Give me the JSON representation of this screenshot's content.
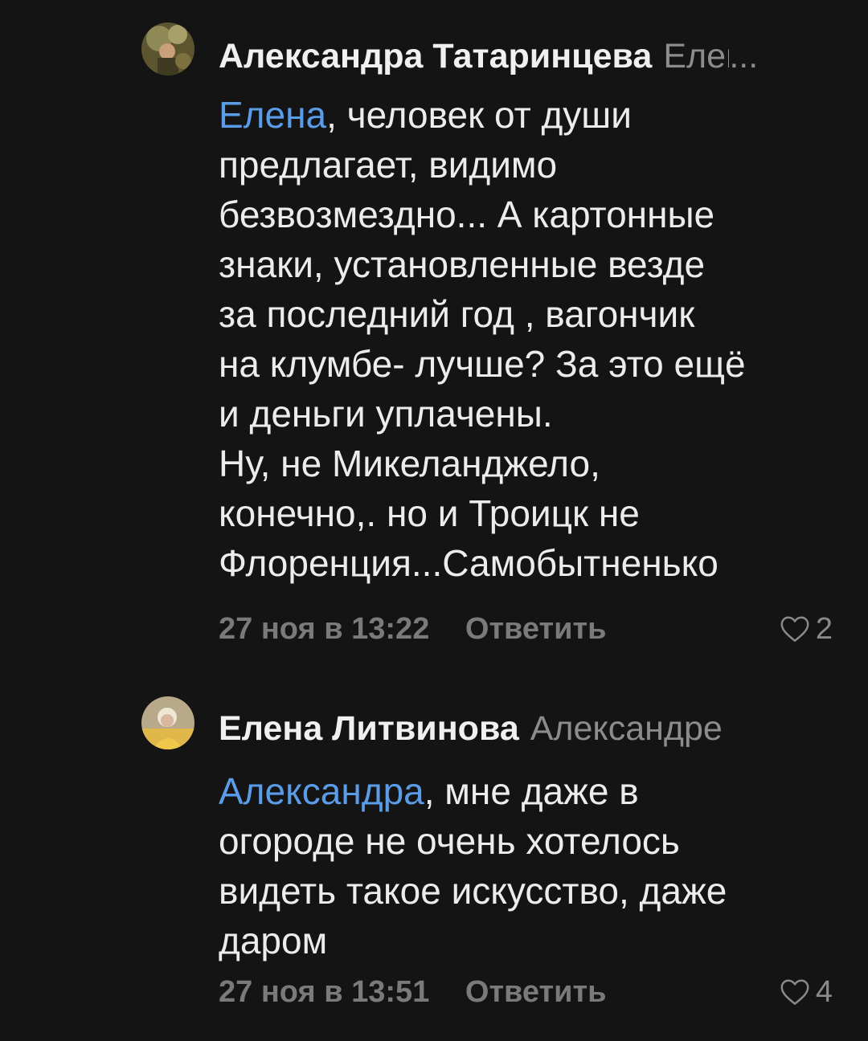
{
  "comments": [
    {
      "author": "Александра Татаринцева",
      "reply_to": "Елена",
      "reply_to_ellipsis": "...",
      "mention": "Елена",
      "lines": [
        ", человек от души",
        "предлагает, видимо",
        "безвозмездно... А  картонные",
        "знаки, установленные везде",
        "за последний год , вагончик",
        "на клумбе- лучше? За это ещё",
        "и деньги уплачены.",
        "Ну, не Микеланджело,",
        "конечно,. но и Троицк не",
        "Флоренция...Самобытненько"
      ],
      "time": "27 ноя в 13:22",
      "reply_label": "Ответить",
      "likes": "2"
    },
    {
      "author": "Елена Литвинова",
      "reply_to": "Александре",
      "mention": "Александра",
      "lines": [
        ", мне даже в",
        "огороде не очень хотелось",
        "видеть такое искусство, даже",
        "даром"
      ],
      "time": "27 ноя в 13:51",
      "reply_label": "Ответить",
      "likes": "4"
    }
  ],
  "colors": {
    "background": "#141414",
    "mention": "#5a9ce8",
    "muted": "#7a7a7a"
  },
  "icons": {
    "like": "heart-outline-icon"
  }
}
